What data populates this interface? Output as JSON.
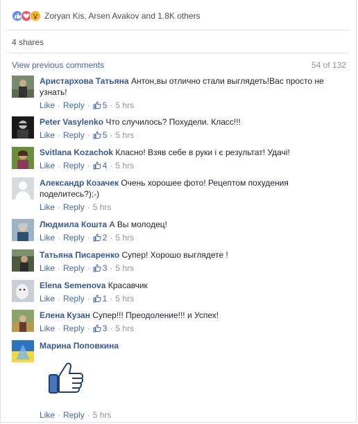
{
  "reactions": {
    "summary": "Zoryan Kis, Arsen Avakov and 1.8K others",
    "icons": [
      "like-icon",
      "love-icon",
      "wow-icon"
    ]
  },
  "shares": "4 shares",
  "comments_header": {
    "view_previous": "View previous comments",
    "count": "54 of 132"
  },
  "actions_labels": {
    "like": "Like",
    "reply": "Reply",
    "sep": "·"
  },
  "comments": [
    {
      "author": "Аристархова Татьяна",
      "text": "Антон,вы отлично стали выглядеть!Вас просто не узнать!",
      "likes": "5",
      "time": "5 hrs"
    },
    {
      "author": "Peter Vasylenko",
      "text": "Что случилось? Похудели. Класс!!!",
      "likes": "5",
      "time": "5 hrs"
    },
    {
      "author": "Svitlana Kozachok",
      "text": "Класно! Взяв себе в руки і є результат! Удачі!",
      "likes": "4",
      "time": "5 hrs"
    },
    {
      "author": "Александр Козачек",
      "text": "Очень хорошее фото! Рецептом похудения поделитесь?);-)",
      "likes": "",
      "time": "5 hrs"
    },
    {
      "author": "Людмила Кошта",
      "text": "А Вы молодец!",
      "likes": "2",
      "time": "5 hrs"
    },
    {
      "author": "Татьяна Писаренко",
      "text": "Супер! Хорошо выглядете !",
      "likes": "3",
      "time": "5 hrs"
    },
    {
      "author": "Elena Semenova",
      "text": "Красавчик",
      "likes": "1",
      "time": "5 hrs"
    },
    {
      "author": "Елена Кузан",
      "text": "Супер!!! Преодоление!!! и Успех!",
      "likes": "3",
      "time": "5 hrs"
    },
    {
      "author": "Марина Поповкина",
      "text": "",
      "likes": "",
      "time": "5 hrs"
    }
  ],
  "colors": {
    "link": "#4267b2",
    "author": "#365899",
    "meta": "#90949c",
    "like_blue": "#5890ff"
  }
}
